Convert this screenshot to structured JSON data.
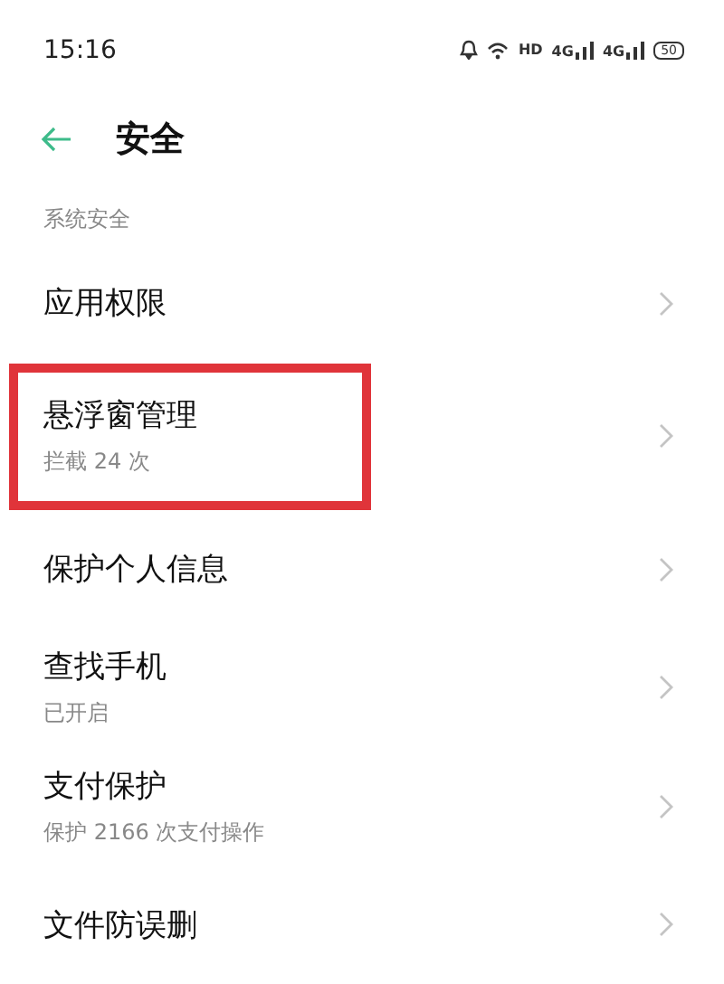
{
  "status_bar": {
    "time": "15:16",
    "network": "HD",
    "sim_1": "4G",
    "sim_2": "4G",
    "battery": "50"
  },
  "header": {
    "title": "安全"
  },
  "section": {
    "label": "系统安全"
  },
  "items": [
    {
      "title": "应用权限",
      "highlighted": false
    },
    {
      "title": "悬浮窗管理",
      "subtitle": "拦截 24 次",
      "highlighted": true
    },
    {
      "title": "保护个人信息",
      "highlighted": false
    },
    {
      "title": "查找手机",
      "subtitle": "已开启",
      "highlighted": false
    },
    {
      "title": "支付保护",
      "subtitle": "保护 2166 次支付操作",
      "highlighted": false
    },
    {
      "title": "文件防误删",
      "highlighted": false
    }
  ]
}
